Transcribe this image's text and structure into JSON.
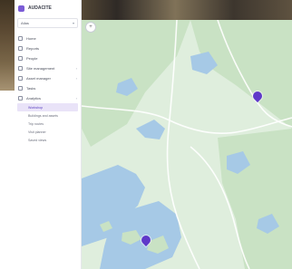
{
  "app": {
    "name": "AUDACITE"
  },
  "workspace": {
    "label": "Atlas"
  },
  "nav": {
    "items": [
      {
        "label": "Home",
        "icon": "home-icon"
      },
      {
        "label": "Reports",
        "icon": "reports-icon"
      },
      {
        "label": "People",
        "icon": "people-icon"
      },
      {
        "label": "Site management",
        "icon": "site-management-icon"
      },
      {
        "label": "Asset manager",
        "icon": "asset-manager-icon"
      },
      {
        "label": "Tasks",
        "icon": "tasks-icon"
      },
      {
        "label": "Analytics",
        "icon": "analytics-icon"
      }
    ],
    "sub_items": [
      {
        "label": "Workshop",
        "active": true
      },
      {
        "label": "Buildings and assets",
        "active": false
      },
      {
        "label": "Trip routes",
        "active": false
      },
      {
        "label": "Visit planner",
        "active": false
      },
      {
        "label": "Saved views",
        "active": false
      }
    ]
  },
  "map": {
    "zoom_label": "+",
    "colors": {
      "land": "#dfeedd",
      "water": "#a6c9e6",
      "forest": "#c9e2c4",
      "road": "#ffffff",
      "marker": "#5f39c9",
      "accent": "#7b5cd6"
    }
  }
}
